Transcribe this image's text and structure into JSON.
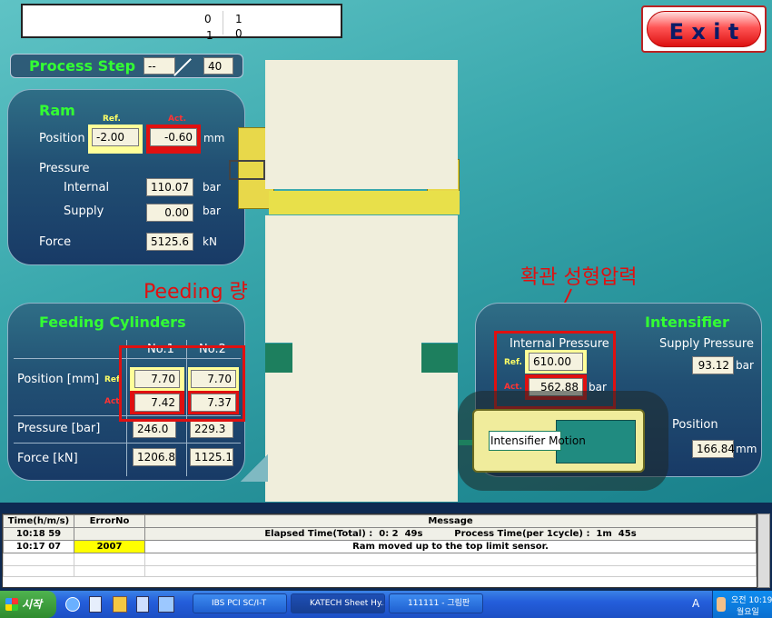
{
  "header": {
    "counter_top_a": "0",
    "counter_top_b": "1",
    "counter_bottom_a": "1",
    "counter_bottom_b": "0"
  },
  "exit_label": "E x i t",
  "process_step": {
    "label": "Process Step",
    "current": "--",
    "total": "40"
  },
  "ram": {
    "title": "Ram",
    "ref_label": "Ref.",
    "act_label": "Act.",
    "position_label": "Position",
    "position_ref": "-2.00",
    "position_act": "-0.60",
    "position_unit": "mm",
    "pressure_label": "Pressure",
    "internal_label": "Internal",
    "internal_value": "110.07",
    "internal_unit": "bar",
    "supply_label": "Supply",
    "supply_value": "0.00",
    "supply_unit": "bar",
    "force_label": "Force",
    "force_value": "5125.6",
    "force_unit": "kN"
  },
  "annotations": {
    "peeding": "Peeding 량",
    "expansion": "확관 성형압력"
  },
  "feeding": {
    "title": "Feeding Cylinders",
    "col1": "No.1",
    "col2": "No.2",
    "position_label": "Position [mm]",
    "ref_label": "Ref",
    "act_label": "Act",
    "pos_ref_1": "7.70",
    "pos_ref_2": "7.70",
    "pos_act_1": "7.42",
    "pos_act_2": "7.37",
    "pressure_label": "Pressure [bar]",
    "pressure_1": "246.0",
    "pressure_2": "229.3",
    "force_label": "Force [kN]",
    "force_1": "1206.8",
    "force_2": "1125.1"
  },
  "intensifier": {
    "title": "Intensifier",
    "internal_pressure_label": "Internal Pressure",
    "ref_label": "Ref.",
    "act_label": "Act.",
    "ref_value": "610.00",
    "act_value": "562.88",
    "pressure_unit": "bar",
    "supply_pressure_label": "Supply Pressure",
    "supply_value": "93.12",
    "supply_unit": "bar",
    "position_label": "Position",
    "position_value": "166.84",
    "position_unit": "mm",
    "motion_label": "Intensifier Motion"
  },
  "log": {
    "headers": {
      "time": "Time(h/m/s)",
      "error": "ErrorNo",
      "message": "Message"
    },
    "row1": {
      "time": "10:18  59",
      "message": "Elapsed Time(Total) :  0: 2  49s          Process Time(per 1cycle) :  1m  45s"
    },
    "row2": {
      "time": "10:17  07",
      "error": "2007",
      "message": "Ram moved up to the top limit sensor."
    }
  },
  "taskbar": {
    "start": "시작",
    "task1": "IBS PCI SC/I-T",
    "task2": "KATECH Sheet Hy...",
    "task3": "111111 - 그림판",
    "lang": "A",
    "time": "오전 10:19",
    "day": "월요일"
  },
  "colors": {
    "accent_green": "#33ff33",
    "alert_red": "#e01010",
    "ref_yellow": "#ffff99"
  }
}
